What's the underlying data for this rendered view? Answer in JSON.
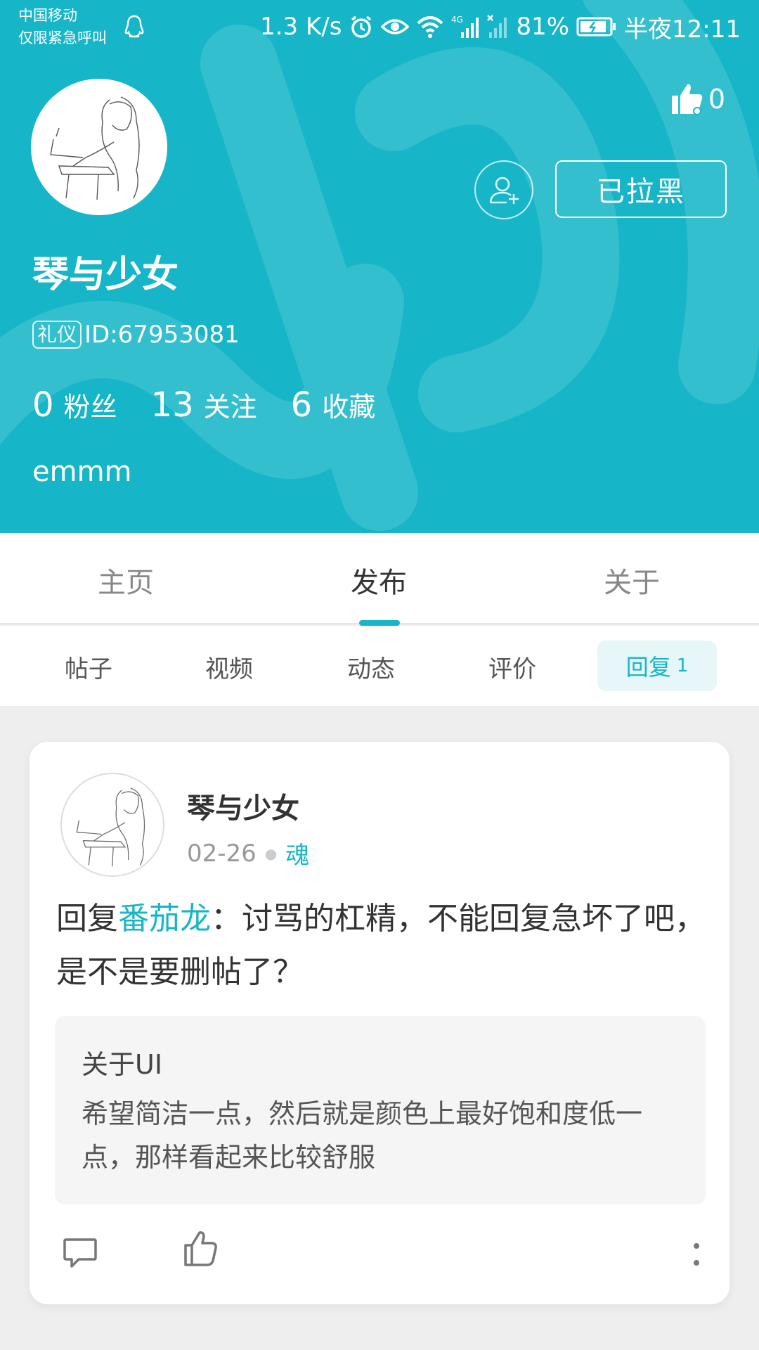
{
  "status_bar": {
    "carrier": "中国移动",
    "carrier_sub": "仅限紧急呼叫",
    "speed": "1.3 K/s",
    "network_tag": "4G",
    "battery": "81%",
    "time": "半夜12:11"
  },
  "profile": {
    "likes": "0",
    "blocked_label": "已拉黑",
    "name": "琴与少女",
    "badge": "礼仪",
    "id_text": "ID:67953081",
    "stats": [
      {
        "value": "0",
        "label": "粉丝"
      },
      {
        "value": "13",
        "label": "关注"
      },
      {
        "value": "6",
        "label": "收藏"
      }
    ],
    "bio": "emmm"
  },
  "tabs": [
    {
      "label": "主页"
    },
    {
      "label": "发布"
    },
    {
      "label": "关于"
    }
  ],
  "active_tab": "发布",
  "subtabs": [
    {
      "label": "帖子"
    },
    {
      "label": "视频"
    },
    {
      "label": "动态"
    },
    {
      "label": "评价"
    }
  ],
  "active_subtab": {
    "label": "回复",
    "count": "1"
  },
  "card": {
    "author": "琴与少女",
    "date": "02-26",
    "category": "魂",
    "reply_prefix": "回复",
    "mention": "番茄龙",
    "reply_body": "：讨骂的杠精，不能回复急坏了吧，是不是要删帖了？",
    "quote_title": "关于UI",
    "quote_body": "希望简洁一点，然后就是颜色上最好饱和度低一点，那样看起来比较舒服"
  },
  "colors": {
    "accent": "#16b6c8",
    "background": "#eeeeee"
  },
  "icons": [
    "qq-icon",
    "alarm-icon",
    "eye-icon",
    "wifi-icon",
    "signal-icon",
    "battery-icon",
    "thumbs-up-icon",
    "add-friend-icon",
    "comment-icon",
    "more-vertical-icon"
  ]
}
